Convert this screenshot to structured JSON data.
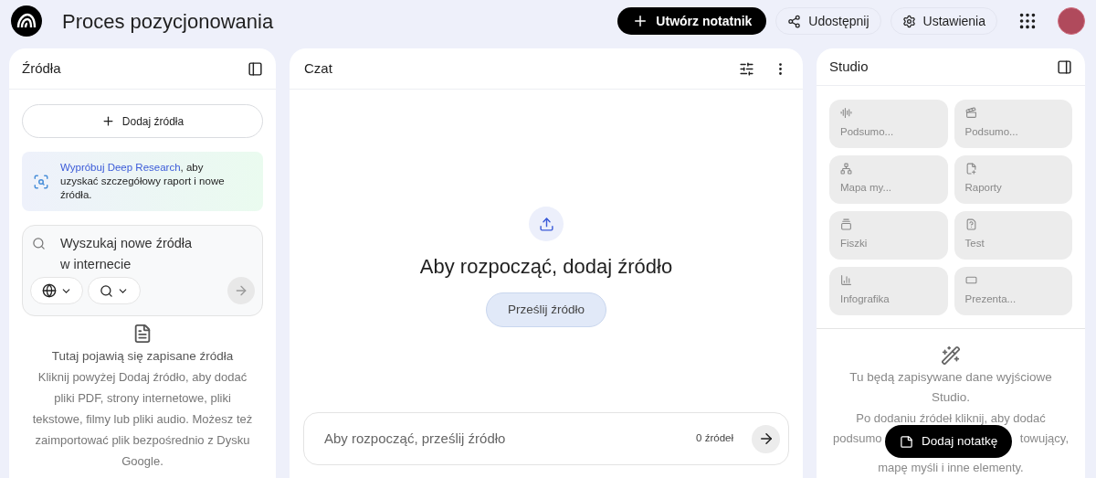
{
  "header": {
    "title": "Proces pozycjonowania",
    "create_button": "Utwórz notatnik",
    "share_button": "Udostępnij",
    "settings_button": "Ustawienia"
  },
  "sources": {
    "title": "Źródła",
    "add_button": "Dodaj źródła",
    "promo": {
      "link": "Wypróbuj Deep Research",
      "text": ", aby uzyskać szczegółowy raport i nowe źródła."
    },
    "search": {
      "placeholder": "Wyszukaj nowe źródła w internecie"
    },
    "empty_title": "Tutaj pojawią się zapisane źródła",
    "empty_text": "Kliknij powyżej Dodaj źródło, aby dodać pliki PDF, strony internetowe, pliki tekstowe, filmy lub pliki audio. Możesz też zaimportować plik bezpośrednio z Dysku Google."
  },
  "chat": {
    "title": "Czat",
    "empty_title": "Aby rozpocząć, dodaj źródło",
    "upload_button": "Prześlij źródło",
    "input": {
      "placeholder": "Aby rozpocząć, prześlij źródło"
    },
    "source_count": "0 źródeł"
  },
  "studio": {
    "title": "Studio",
    "tiles": [
      {
        "label": "Podsumo..."
      },
      {
        "label": "Podsumo..."
      },
      {
        "label": "Mapa my..."
      },
      {
        "label": "Raporty"
      },
      {
        "label": "Fiszki"
      },
      {
        "label": "Test"
      },
      {
        "label": "Infografika"
      },
      {
        "label": "Prezenta..."
      }
    ],
    "empty_title": "Tu będą zapisywane dane wyjściowe Studio.",
    "empty_line": "Po dodaniu źródeł kliknij, aby dodać",
    "empty_left": "podsumo",
    "empty_right": "towujący,",
    "empty_last": "mapę myśli i inne elementy.",
    "note_button": "Dodaj notatkę"
  }
}
